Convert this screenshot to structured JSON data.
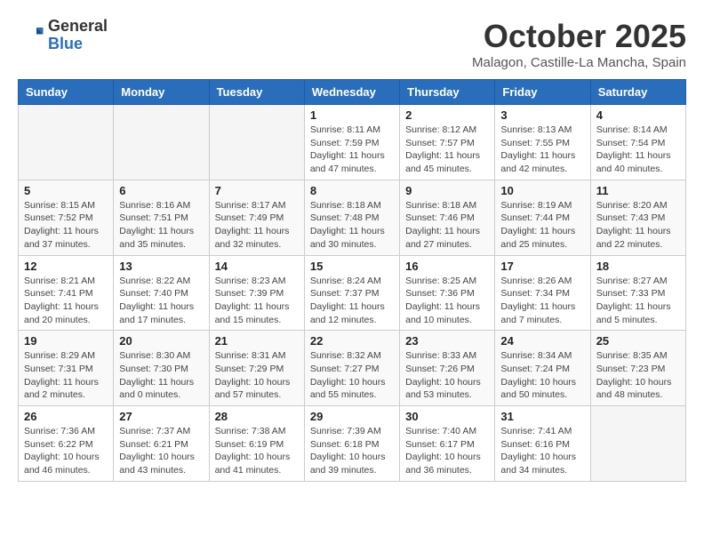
{
  "header": {
    "logo_general": "General",
    "logo_blue": "Blue",
    "title": "October 2025",
    "subtitle": "Malagon, Castille-La Mancha, Spain"
  },
  "weekdays": [
    "Sunday",
    "Monday",
    "Tuesday",
    "Wednesday",
    "Thursday",
    "Friday",
    "Saturday"
  ],
  "weeks": [
    [
      {
        "day": "",
        "info": ""
      },
      {
        "day": "",
        "info": ""
      },
      {
        "day": "",
        "info": ""
      },
      {
        "day": "1",
        "info": "Sunrise: 8:11 AM\nSunset: 7:59 PM\nDaylight: 11 hours and 47 minutes."
      },
      {
        "day": "2",
        "info": "Sunrise: 8:12 AM\nSunset: 7:57 PM\nDaylight: 11 hours and 45 minutes."
      },
      {
        "day": "3",
        "info": "Sunrise: 8:13 AM\nSunset: 7:55 PM\nDaylight: 11 hours and 42 minutes."
      },
      {
        "day": "4",
        "info": "Sunrise: 8:14 AM\nSunset: 7:54 PM\nDaylight: 11 hours and 40 minutes."
      }
    ],
    [
      {
        "day": "5",
        "info": "Sunrise: 8:15 AM\nSunset: 7:52 PM\nDaylight: 11 hours and 37 minutes."
      },
      {
        "day": "6",
        "info": "Sunrise: 8:16 AM\nSunset: 7:51 PM\nDaylight: 11 hours and 35 minutes."
      },
      {
        "day": "7",
        "info": "Sunrise: 8:17 AM\nSunset: 7:49 PM\nDaylight: 11 hours and 32 minutes."
      },
      {
        "day": "8",
        "info": "Sunrise: 8:18 AM\nSunset: 7:48 PM\nDaylight: 11 hours and 30 minutes."
      },
      {
        "day": "9",
        "info": "Sunrise: 8:18 AM\nSunset: 7:46 PM\nDaylight: 11 hours and 27 minutes."
      },
      {
        "day": "10",
        "info": "Sunrise: 8:19 AM\nSunset: 7:44 PM\nDaylight: 11 hours and 25 minutes."
      },
      {
        "day": "11",
        "info": "Sunrise: 8:20 AM\nSunset: 7:43 PM\nDaylight: 11 hours and 22 minutes."
      }
    ],
    [
      {
        "day": "12",
        "info": "Sunrise: 8:21 AM\nSunset: 7:41 PM\nDaylight: 11 hours and 20 minutes."
      },
      {
        "day": "13",
        "info": "Sunrise: 8:22 AM\nSunset: 7:40 PM\nDaylight: 11 hours and 17 minutes."
      },
      {
        "day": "14",
        "info": "Sunrise: 8:23 AM\nSunset: 7:39 PM\nDaylight: 11 hours and 15 minutes."
      },
      {
        "day": "15",
        "info": "Sunrise: 8:24 AM\nSunset: 7:37 PM\nDaylight: 11 hours and 12 minutes."
      },
      {
        "day": "16",
        "info": "Sunrise: 8:25 AM\nSunset: 7:36 PM\nDaylight: 11 hours and 10 minutes."
      },
      {
        "day": "17",
        "info": "Sunrise: 8:26 AM\nSunset: 7:34 PM\nDaylight: 11 hours and 7 minutes."
      },
      {
        "day": "18",
        "info": "Sunrise: 8:27 AM\nSunset: 7:33 PM\nDaylight: 11 hours and 5 minutes."
      }
    ],
    [
      {
        "day": "19",
        "info": "Sunrise: 8:29 AM\nSunset: 7:31 PM\nDaylight: 11 hours and 2 minutes."
      },
      {
        "day": "20",
        "info": "Sunrise: 8:30 AM\nSunset: 7:30 PM\nDaylight: 11 hours and 0 minutes."
      },
      {
        "day": "21",
        "info": "Sunrise: 8:31 AM\nSunset: 7:29 PM\nDaylight: 10 hours and 57 minutes."
      },
      {
        "day": "22",
        "info": "Sunrise: 8:32 AM\nSunset: 7:27 PM\nDaylight: 10 hours and 55 minutes."
      },
      {
        "day": "23",
        "info": "Sunrise: 8:33 AM\nSunset: 7:26 PM\nDaylight: 10 hours and 53 minutes."
      },
      {
        "day": "24",
        "info": "Sunrise: 8:34 AM\nSunset: 7:24 PM\nDaylight: 10 hours and 50 minutes."
      },
      {
        "day": "25",
        "info": "Sunrise: 8:35 AM\nSunset: 7:23 PM\nDaylight: 10 hours and 48 minutes."
      }
    ],
    [
      {
        "day": "26",
        "info": "Sunrise: 7:36 AM\nSunset: 6:22 PM\nDaylight: 10 hours and 46 minutes."
      },
      {
        "day": "27",
        "info": "Sunrise: 7:37 AM\nSunset: 6:21 PM\nDaylight: 10 hours and 43 minutes."
      },
      {
        "day": "28",
        "info": "Sunrise: 7:38 AM\nSunset: 6:19 PM\nDaylight: 10 hours and 41 minutes."
      },
      {
        "day": "29",
        "info": "Sunrise: 7:39 AM\nSunset: 6:18 PM\nDaylight: 10 hours and 39 minutes."
      },
      {
        "day": "30",
        "info": "Sunrise: 7:40 AM\nSunset: 6:17 PM\nDaylight: 10 hours and 36 minutes."
      },
      {
        "day": "31",
        "info": "Sunrise: 7:41 AM\nSunset: 6:16 PM\nDaylight: 10 hours and 34 minutes."
      },
      {
        "day": "",
        "info": ""
      }
    ]
  ]
}
